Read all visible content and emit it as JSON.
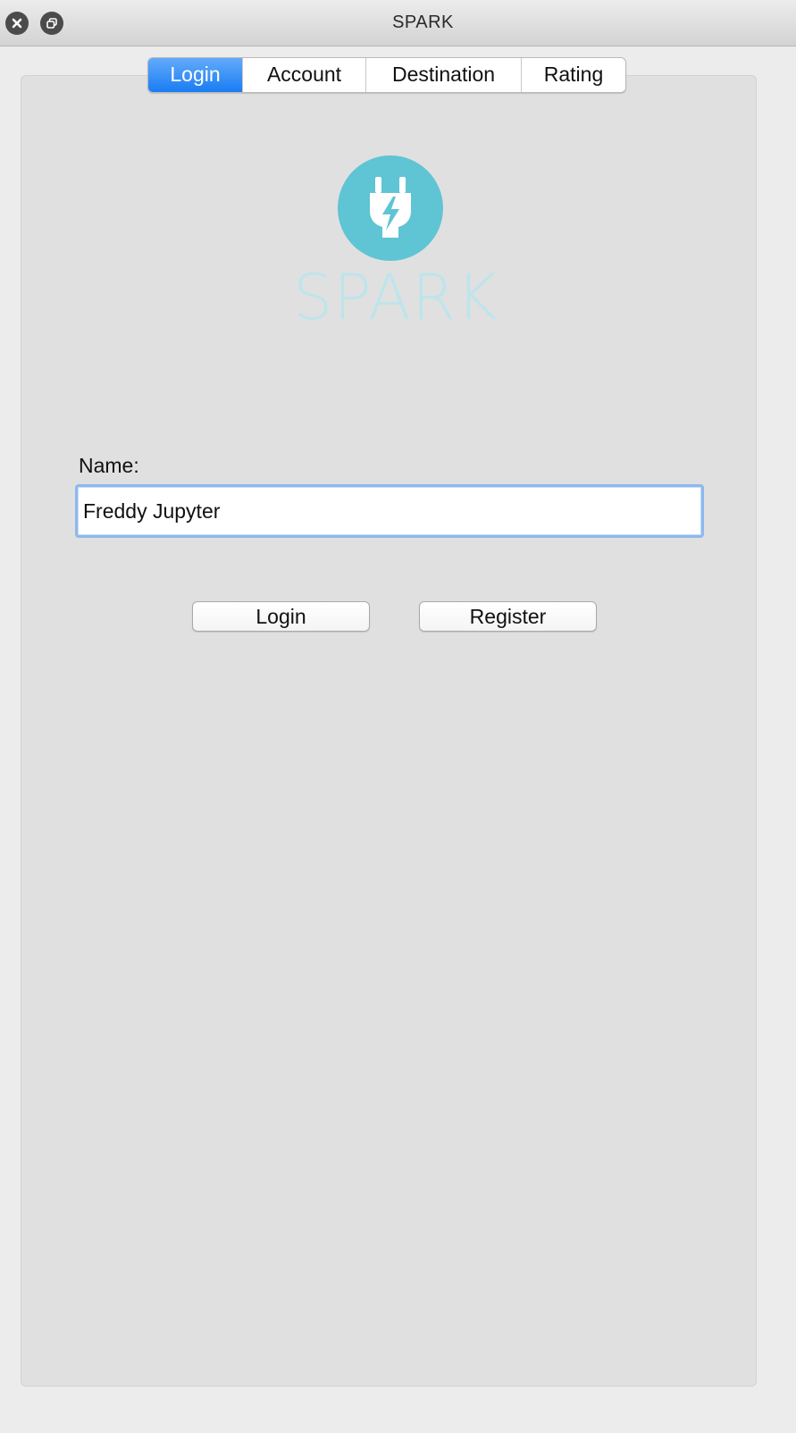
{
  "window": {
    "title": "SPARK",
    "close_icon": "close-icon",
    "restore_icon": "restore-icon"
  },
  "tabs": [
    {
      "label": "Login",
      "active": true
    },
    {
      "label": "Account",
      "active": false
    },
    {
      "label": "Destination",
      "active": false
    },
    {
      "label": "Rating",
      "active": false
    }
  ],
  "logo": {
    "icon": "plug-lightning-icon",
    "text": "SPARK",
    "circle_color": "#5fc4d4",
    "text_color": "#b7e6ee"
  },
  "form": {
    "name_label": "Name:",
    "name_value": "Freddy Jupyter",
    "login_button": "Login",
    "register_button": "Register"
  },
  "colors": {
    "active_tab": "#1a7cf3",
    "focus_ring": "#8db8ef"
  }
}
